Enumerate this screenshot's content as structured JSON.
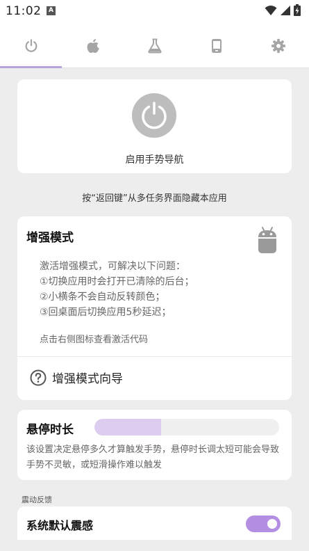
{
  "status_bar": {
    "time": "11:02",
    "icons": [
      "notification-a-icon",
      "wifi-icon",
      "signal-icon",
      "battery-charging-icon"
    ]
  },
  "tabs": [
    {
      "icon": "power-icon",
      "selected": true
    },
    {
      "icon": "apple-icon",
      "selected": false
    },
    {
      "icon": "flask-icon",
      "selected": false
    },
    {
      "icon": "phone-icon",
      "selected": false
    },
    {
      "icon": "gear-icon",
      "selected": false
    }
  ],
  "power_card": {
    "label": "启用手势导航"
  },
  "hint": "按“返回键”从多任务界面隐藏本应用",
  "enhanced_card": {
    "title": "增强模式",
    "intro": "激活增强模式，可解决以下问题：",
    "issues": [
      "①切换应用时会打开已清除的后台；",
      "②小横条不会自动反转颜色；",
      "③回桌面后切换应用5秒延迟；"
    ],
    "tip": "点击右侧图标查看激活代码",
    "guide_label": "增强模式向导",
    "android_icon": "android-icon"
  },
  "hover_card": {
    "title": "悬停时长",
    "slider_fraction": 0.36,
    "description": "该设置决定悬停多久才算触发手势，悬停时长调太短可能会导致手势不灵敏，或短滑操作难以触发"
  },
  "vibration": {
    "section_label": "震动反馈",
    "system_default_label": "系统默认震感",
    "system_default_on": true
  },
  "colors": {
    "accent": "#b48ee3",
    "slider_fill": "#dcccf0",
    "tab_indicator": "#b9a3dc",
    "background": "#ededed"
  }
}
